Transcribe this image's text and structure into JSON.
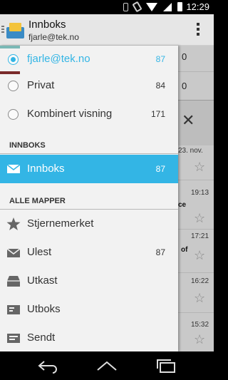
{
  "status_bar": {
    "time": "12:29"
  },
  "action_bar": {
    "title": "Innboks",
    "subtitle": "fjarle@tek.no"
  },
  "accounts": [
    {
      "label": "fjarle@tek.no",
      "count": "87",
      "selected": true
    },
    {
      "label": "Privat",
      "count": "84",
      "selected": false
    },
    {
      "label": "Kombinert visning",
      "count": "171",
      "selected": false
    }
  ],
  "inbox_section": {
    "header": "INNBOKS",
    "item": {
      "label": "Innboks",
      "count": "87"
    }
  },
  "folders_section": {
    "header": "ALLE MAPPER",
    "items": [
      {
        "label": "Stjernemerket",
        "count": "",
        "icon": "star-icon"
      },
      {
        "label": "Ulest",
        "count": "87",
        "icon": "open-envelope-icon"
      },
      {
        "label": "Utkast",
        "count": "",
        "icon": "draft-icon"
      },
      {
        "label": "Utboks",
        "count": "",
        "icon": "outbox-icon"
      },
      {
        "label": "Sendt",
        "count": "",
        "icon": "sent-icon"
      }
    ]
  },
  "background": {
    "counts": [
      "0",
      "0"
    ],
    "dates": [
      "23. nov.",
      "19:13",
      "17:21",
      "16:22",
      "15:32"
    ],
    "snippets": [
      "ce",
      "of"
    ]
  },
  "colors": {
    "accent": "#33b5e5",
    "drawer_bg": "#f2f2f2",
    "actionbar_bg": "#e6e6e6"
  }
}
